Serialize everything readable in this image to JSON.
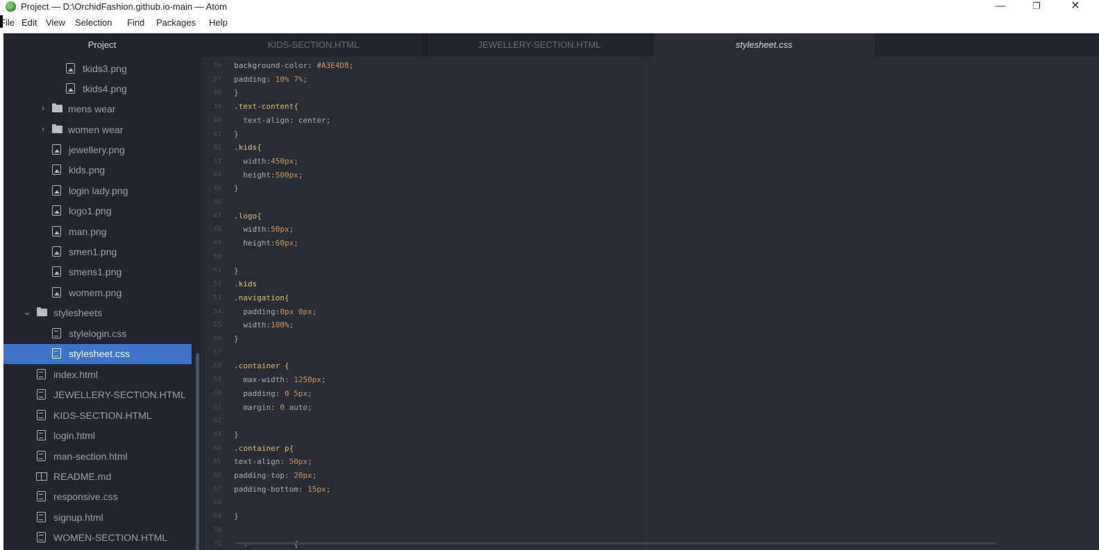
{
  "window": {
    "title": "Project — D:\\OrchidFashion.github.io-main — Atom",
    "minimize_glyph": "—",
    "maximize_glyph": "❐",
    "close_glyph": "✕"
  },
  "menu": [
    "File",
    "Edit",
    "View",
    "Selection",
    "Find",
    "Packages",
    "Help"
  ],
  "sidebar": {
    "title": "Project",
    "items": [
      {
        "label": "tkids3.png",
        "icon": "image-file-icon"
      },
      {
        "label": "tkids4.png",
        "icon": "image-file-icon"
      },
      {
        "label": "mens wear",
        "icon": "folder-icon",
        "chevron": "›"
      },
      {
        "label": "women wear",
        "icon": "folder-icon",
        "chevron": "›"
      },
      {
        "label": "jewellery.png",
        "icon": "image-file-icon"
      },
      {
        "label": "kids.png",
        "icon": "image-file-icon"
      },
      {
        "label": "login lady.png",
        "icon": "image-file-icon"
      },
      {
        "label": "logo1.png",
        "icon": "image-file-icon"
      },
      {
        "label": "man.png",
        "icon": "image-file-icon"
      },
      {
        "label": "smen1.png",
        "icon": "image-file-icon"
      },
      {
        "label": "smens1.png",
        "icon": "image-file-icon"
      },
      {
        "label": "womem.png",
        "icon": "image-file-icon"
      },
      {
        "label": "stylesheets",
        "icon": "folder-icon",
        "chevron": "⌄"
      },
      {
        "label": "stylelogin.css",
        "icon": "text-file-icon"
      },
      {
        "label": "stylesheet.css",
        "icon": "text-file-icon",
        "selected": true
      },
      {
        "label": "index.html",
        "icon": "text-file-icon"
      },
      {
        "label": "JEWELLERY-SECTION.HTML",
        "icon": "text-file-icon"
      },
      {
        "label": "KIDS-SECTION.HTML",
        "icon": "text-file-icon"
      },
      {
        "label": "login.html",
        "icon": "text-file-icon"
      },
      {
        "label": "man-section.html",
        "icon": "text-file-icon"
      },
      {
        "label": "README.md",
        "icon": "book-icon"
      },
      {
        "label": "responsive.css",
        "icon": "text-file-icon"
      },
      {
        "label": "signup.html",
        "icon": "text-file-icon"
      },
      {
        "label": "WOMEN-SECTION.HTML",
        "icon": "text-file-icon"
      }
    ]
  },
  "tabs": [
    {
      "label": "KIDS-SECTION.HTML",
      "active": false
    },
    {
      "label": "JEWELLERY-SECTION.HTML",
      "active": false
    },
    {
      "label": "stylesheet.css",
      "active": true
    }
  ],
  "editor": {
    "lines": [
      {
        "no": "36",
        "segs": [
          [
            "prop",
            "background-color: "
          ],
          [
            "num",
            "#A3E4D8"
          ],
          [
            "prop",
            ";"
          ]
        ]
      },
      {
        "no": "37",
        "segs": [
          [
            "prop",
            "padding: "
          ],
          [
            "num",
            "10% 7%"
          ],
          [
            "prop",
            ";"
          ]
        ]
      },
      {
        "no": "38",
        "segs": [
          [
            "prop",
            "}"
          ]
        ]
      },
      {
        "no": "39",
        "segs": [
          [
            "sel",
            ".text-content{"
          ]
        ]
      },
      {
        "no": "40",
        "segs": [
          [
            "prop",
            "  text-align: center;"
          ]
        ]
      },
      {
        "no": "41",
        "segs": [
          [
            "prop",
            "}"
          ]
        ]
      },
      {
        "no": "42",
        "segs": [
          [
            "sel",
            ".kids{"
          ]
        ]
      },
      {
        "no": "43",
        "segs": [
          [
            "prop",
            "  width:"
          ],
          [
            "num",
            "450px"
          ],
          [
            "prop",
            ";"
          ]
        ]
      },
      {
        "no": "44",
        "segs": [
          [
            "prop",
            "  height:"
          ],
          [
            "num",
            "500px"
          ],
          [
            "prop",
            ";"
          ]
        ]
      },
      {
        "no": "45",
        "segs": [
          [
            "prop",
            "}"
          ]
        ]
      },
      {
        "no": "46",
        "segs": []
      },
      {
        "no": "47",
        "segs": [
          [
            "sel",
            ".logo{"
          ]
        ]
      },
      {
        "no": "48",
        "segs": [
          [
            "prop",
            "  width:"
          ],
          [
            "num",
            "50px"
          ],
          [
            "prop",
            ";"
          ]
        ]
      },
      {
        "no": "49",
        "segs": [
          [
            "prop",
            "  height:"
          ],
          [
            "num",
            "60px"
          ],
          [
            "prop",
            ";"
          ]
        ]
      },
      {
        "no": "50",
        "segs": []
      },
      {
        "no": "51",
        "segs": [
          [
            "prop",
            "}"
          ]
        ]
      },
      {
        "no": "52",
        "segs": [
          [
            "sel",
            ".kids"
          ]
        ]
      },
      {
        "no": "53",
        "segs": [
          [
            "sel",
            ".navigation{"
          ]
        ]
      },
      {
        "no": "54",
        "segs": [
          [
            "prop",
            "  padding:"
          ],
          [
            "num",
            "0px 0px"
          ],
          [
            "prop",
            ";"
          ]
        ]
      },
      {
        "no": "55",
        "segs": [
          [
            "prop",
            "  width:"
          ],
          [
            "num",
            "100%"
          ],
          [
            "prop",
            ";"
          ]
        ]
      },
      {
        "no": "56",
        "segs": [
          [
            "prop",
            "}"
          ]
        ]
      },
      {
        "no": "57",
        "segs": []
      },
      {
        "no": "58",
        "segs": [
          [
            "sel",
            ".container {"
          ]
        ]
      },
      {
        "no": "59",
        "segs": [
          [
            "prop",
            "  max-width: "
          ],
          [
            "num",
            "1250px"
          ],
          [
            "prop",
            ";"
          ]
        ]
      },
      {
        "no": "60",
        "segs": [
          [
            "prop",
            "  padding: "
          ],
          [
            "num",
            "0 5px"
          ],
          [
            "prop",
            ";"
          ]
        ]
      },
      {
        "no": "61",
        "segs": [
          [
            "prop",
            "  margin: "
          ],
          [
            "num",
            "0"
          ],
          [
            "prop",
            " auto;"
          ]
        ]
      },
      {
        "no": "62",
        "segs": []
      },
      {
        "no": "63",
        "segs": [
          [
            "prop",
            "}"
          ]
        ]
      },
      {
        "no": "64",
        "segs": [
          [
            "sel",
            ".container p{"
          ]
        ]
      },
      {
        "no": "65",
        "segs": [
          [
            "prop",
            "text-align: "
          ],
          [
            "num",
            "50px"
          ],
          [
            "prop",
            ";"
          ]
        ]
      },
      {
        "no": "66",
        "segs": [
          [
            "prop",
            "padding-top: "
          ],
          [
            "num",
            "20px"
          ],
          [
            "prop",
            ";"
          ]
        ]
      },
      {
        "no": "67",
        "segs": [
          [
            "prop",
            "padding-bottom: "
          ],
          [
            "num",
            "15px"
          ],
          [
            "prop",
            ";"
          ]
        ]
      },
      {
        "no": "68",
        "segs": []
      },
      {
        "no": "69",
        "segs": [
          [
            "prop",
            "}"
          ]
        ]
      },
      {
        "no": "70",
        "segs": []
      },
      {
        "no": "71",
        "segs": [
          [
            "prop",
            "  .          {"
          ]
        ]
      }
    ]
  }
}
